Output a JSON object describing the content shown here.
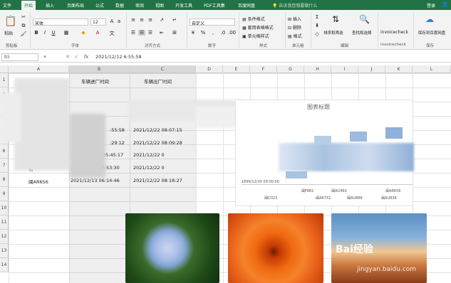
{
  "tabs": [
    "文件",
    "开始",
    "插入",
    "页面布局",
    "公式",
    "数据",
    "审阅",
    "视图",
    "开发工具",
    "PDF工具集",
    "百度网盘"
  ],
  "active_tab": "开始",
  "tell_me": "告诉我您想要做什么",
  "login": "登录",
  "ribbon": {
    "paste": "粘贴",
    "clipboard": "剪贴板",
    "font_name": "宋体",
    "font_size": "12",
    "font_group": "字体",
    "align_group": "对齐方式",
    "number_format": "自定义",
    "number_group": "数字",
    "cond_format": "条件格式",
    "table_format": "套用表格格式",
    "cell_style": "单元格样式",
    "styles_group": "样式",
    "insert": "插入",
    "delete": "删除",
    "format": "格式",
    "cells_group": "单元格",
    "sort": "排序和筛选",
    "find": "查找和选择",
    "edit_group": "编辑",
    "invoice": "invoicecheck",
    "save_baidu": "保存到百度网盘",
    "save_group": "保存"
  },
  "formula_bar": {
    "name": "B5",
    "fx": "fx",
    "value": "2021/12/12  6:55:58"
  },
  "columns": [
    "A",
    "B",
    "C",
    "D",
    "E",
    "F",
    "G",
    "H",
    "I",
    "J",
    "K",
    "L"
  ],
  "rows": [
    "1",
    "2",
    "3",
    "4",
    "5",
    "6",
    "7",
    "8",
    "9",
    "10",
    "11",
    "12",
    "13",
    "14"
  ],
  "headers": {
    "b1": "车辆进厂时间",
    "c1": "车辆出厂时间"
  },
  "cells": {
    "b5": ":55:58",
    "c5": "2021/12/22  08:07:15",
    "b6": ":29:12",
    "c6": "2021/12/22  08:09:28",
    "b7": "05:45:17",
    "c7": "2021/12/22  0",
    "b8": "2021/09/22  06:53:30",
    "c8": "2021/12/22  0",
    "a9": "闽AR656",
    "b9": "2021/12/13  06:14:46",
    "c9": "2021/12/22  08:18:27",
    "a8": "粘"
  },
  "chart": {
    "title": "图表标题",
    "axis_label": "1899/12/30 00:00:00",
    "labels": [
      "闽F881",
      "闽AU360",
      "闽AR656",
      "闽D323",
      "闽AR751",
      "闽AU888",
      "闽AU838"
    ]
  },
  "watermark": {
    "brand": "Bai经验",
    "url": "jingyan.baidu.com"
  }
}
